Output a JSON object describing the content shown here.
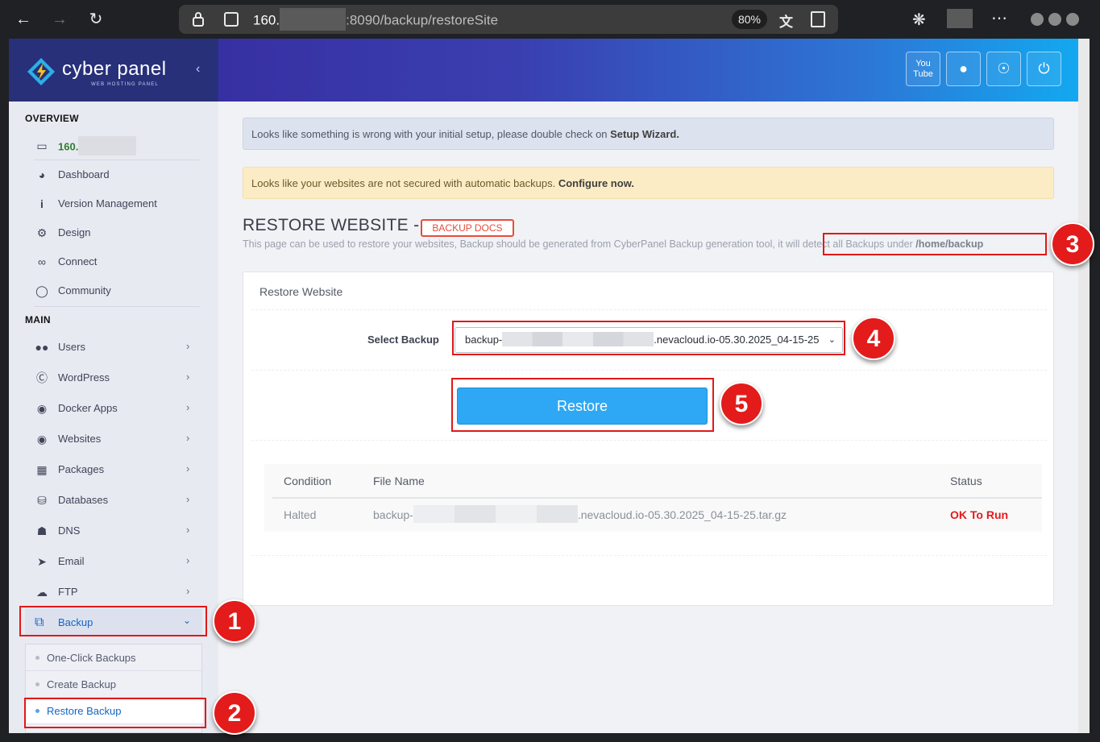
{
  "browser": {
    "url_host": "160.",
    "url_path": ":8090/backup/restoreSite",
    "zoom": "80%",
    "back_icon": "arrow-left-icon",
    "forward_icon": "arrow-right-icon",
    "reload_icon": "reload-icon"
  },
  "brand": {
    "name": "cyber panel",
    "tagline": "WEB HOSTING PANEL"
  },
  "sidebar": {
    "overview_title": "OVERVIEW",
    "main_title": "MAIN",
    "ip_label": "160.",
    "overview_items": [
      {
        "label": "Dashboard",
        "icon": "dashboard-icon"
      },
      {
        "label": "Version Management",
        "icon": "info-icon"
      },
      {
        "label": "Design",
        "icon": "gear-icon"
      },
      {
        "label": "Connect",
        "icon": "link-icon"
      },
      {
        "label": "Community",
        "icon": "chat-icon"
      }
    ],
    "main_items": [
      {
        "label": "Users",
        "icon": "users-icon"
      },
      {
        "label": "WordPress",
        "icon": "wordpress-icon"
      },
      {
        "label": "Docker Apps",
        "icon": "globe-icon"
      },
      {
        "label": "Websites",
        "icon": "globe-icon"
      },
      {
        "label": "Packages",
        "icon": "cubes-icon"
      },
      {
        "label": "Databases",
        "icon": "database-icon"
      },
      {
        "label": "DNS",
        "icon": "sitemap-icon"
      },
      {
        "label": "Email",
        "icon": "paper-plane-icon"
      },
      {
        "label": "FTP",
        "icon": "cloud-upload-icon"
      }
    ],
    "backup_label": "Backup",
    "backup_sub": [
      "One-Click Backups",
      "Create Backup",
      "Restore Backup"
    ]
  },
  "alerts": {
    "setup_text": "Looks like something is wrong with your initial setup, please double check on ",
    "setup_link": "Setup Wizard.",
    "backup_text": "Looks like your websites are not secured with automatic backups. ",
    "backup_link": "Configure now."
  },
  "page": {
    "title": "RESTORE WEBSITE -",
    "docs_badge": "BACKUP DOCS",
    "desc": "This page can be used to restore your websites, Backup should be generated from CyberPanel Backup generation tool, it will detect all Backups under ",
    "desc_path": "/home/backup"
  },
  "card": {
    "title": "Restore Website",
    "select_label": "Select Backup",
    "select_prefix": "backup-",
    "select_suffix": ".nevacloud.io-05.30.2025_04-15-25",
    "restore_button": "Restore"
  },
  "results": {
    "headers": [
      "Condition",
      "File Name",
      "Status"
    ],
    "row": {
      "condition": "Halted",
      "file_prefix": "backup-",
      "file_suffix": ".nevacloud.io-05.30.2025_04-15-25.tar.gz",
      "status": "OK To Run"
    }
  },
  "callouts": [
    "1",
    "2",
    "3",
    "4",
    "5"
  ],
  "colors": {
    "accent": "#2ea8f4",
    "callout": "#e31b1b",
    "status_ok": "#e41a1a"
  }
}
